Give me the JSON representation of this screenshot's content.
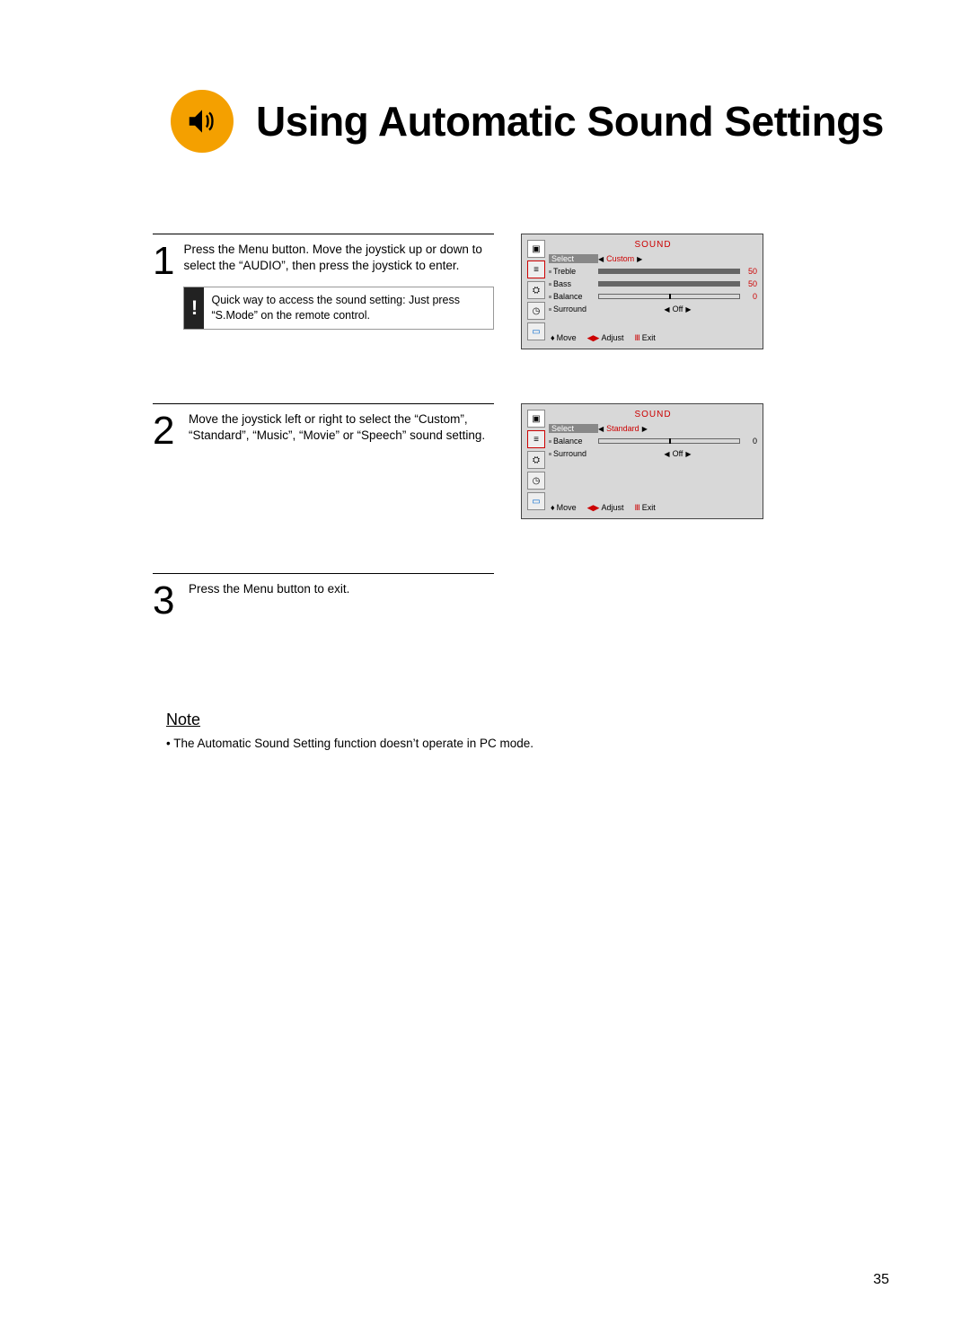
{
  "title": "Using Automatic Sound Settings",
  "steps": {
    "s1": {
      "num": "1",
      "text": "Press the Menu button. Move the joystick up or down to select the “AUDIO”, then press the joystick to enter.",
      "tip": "Quick way to access the sound setting: Just press “S.Mode” on the remote control."
    },
    "s2": {
      "num": "2",
      "text": "Move the joystick left or right to select the “Custom”, “Standard”, “Music”, “Movie” or “Speech” sound setting."
    },
    "s3": {
      "num": "3",
      "text": "Press the Menu button to exit."
    }
  },
  "osd1": {
    "title": "SOUND",
    "rows": {
      "select_label": "Select",
      "select_value": "Custom",
      "treble_label": "Treble",
      "treble_value": "50",
      "bass_label": "Bass",
      "bass_value": "50",
      "balance_label": "Balance",
      "balance_value": "0",
      "surround_label": "Surround",
      "surround_value": "Off"
    },
    "footer": {
      "move": "Move",
      "adjust": "Adjust",
      "exit": "Exit"
    }
  },
  "osd2": {
    "title": "SOUND",
    "rows": {
      "select_label": "Select",
      "select_value": "Standard",
      "balance_label": "Balance",
      "balance_value": "0",
      "surround_label": "Surround",
      "surround_value": "Off"
    },
    "footer": {
      "move": "Move",
      "adjust": "Adjust",
      "exit": "Exit"
    }
  },
  "note": {
    "header": "Note",
    "bullet": "• The Automatic Sound Setting function doesn’t operate in PC mode."
  },
  "page_number": "35"
}
